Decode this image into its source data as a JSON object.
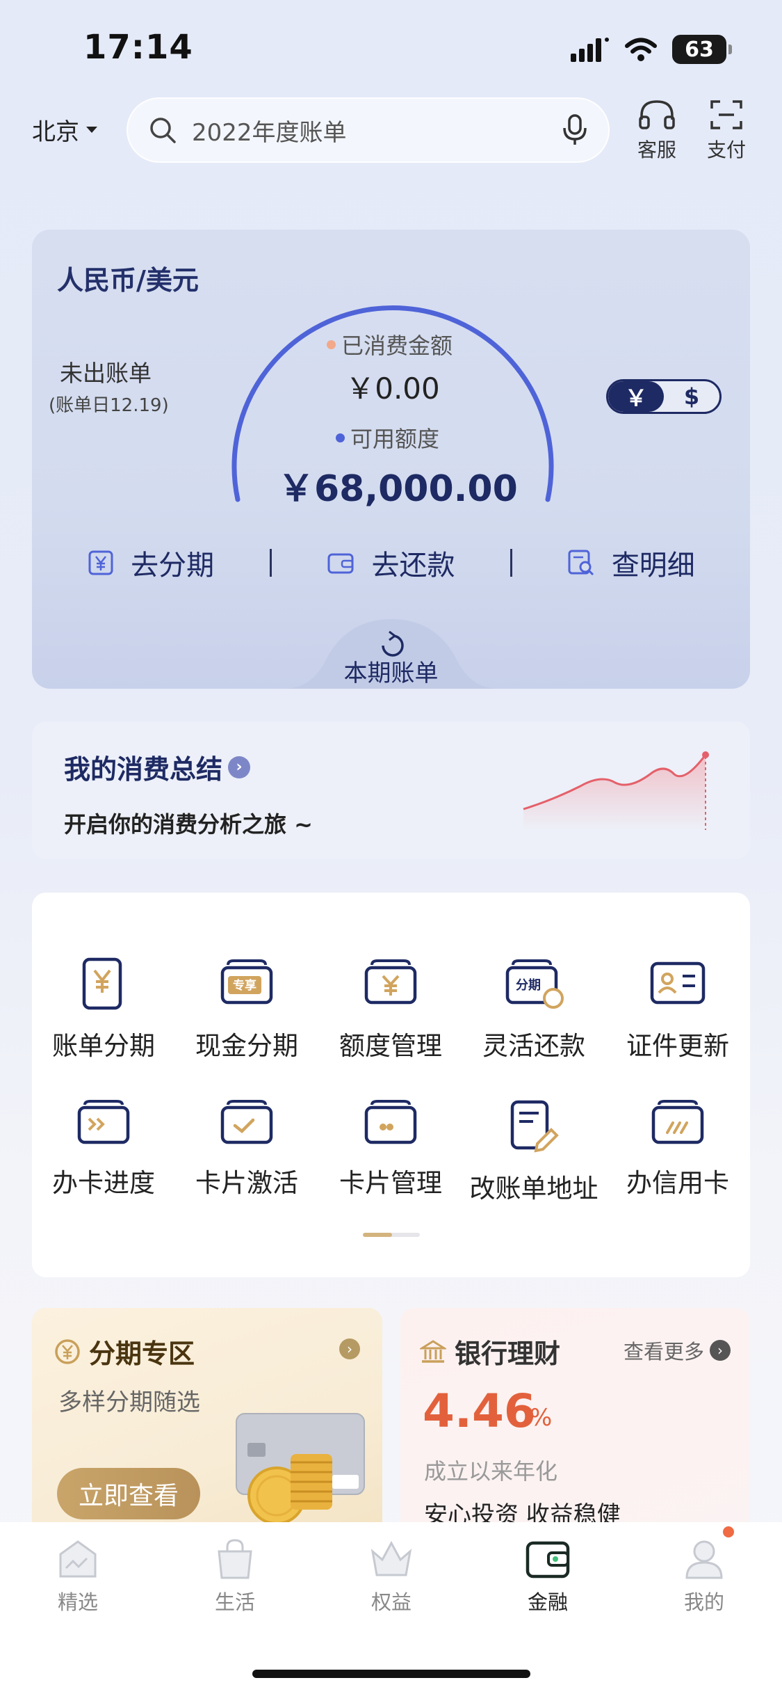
{
  "status": {
    "time": "17:14",
    "battery": "63"
  },
  "header": {
    "city": "北京",
    "search_placeholder": "2022年度账单",
    "service_label": "客服",
    "pay_label": "支付"
  },
  "card": {
    "currency_title": "人民币/美元",
    "bill_status": "未出账单",
    "bill_date": "(账单日12.19)",
    "used_label": "已消费金额",
    "used_value": "￥0.00",
    "available_label": "可用额度",
    "available_value": "￥68,000.00",
    "currency_toggle": [
      "￥",
      "$"
    ],
    "actions": [
      {
        "label": "去分期",
        "icon": "yuan-icon"
      },
      {
        "label": "去还款",
        "icon": "wallet-icon"
      },
      {
        "label": "查明细",
        "icon": "detail-search-icon"
      }
    ],
    "bill_tab_label": "本期账单",
    "colors": {
      "gauge": "#4f63d8",
      "used_dot": "#f2a98a",
      "avail_dot": "#4f63d8"
    }
  },
  "summary": {
    "title": "我的消费总结",
    "subtitle": "开启你的消费分析之旅 ~"
  },
  "menu": {
    "items": [
      {
        "label": "账单分期",
        "icon": "bill-installment-icon"
      },
      {
        "label": "现金分期",
        "icon": "cash-installment-icon",
        "badge": "专享"
      },
      {
        "label": "额度管理",
        "icon": "limit-management-icon"
      },
      {
        "label": "灵活还款",
        "icon": "flexible-repay-icon",
        "badge": "分期"
      },
      {
        "label": "证件更新",
        "icon": "id-update-icon"
      },
      {
        "label": "办卡进度",
        "icon": "card-progress-icon"
      },
      {
        "label": "卡片激活",
        "icon": "card-activate-icon"
      },
      {
        "label": "卡片管理",
        "icon": "card-manage-icon"
      },
      {
        "label": "改账单地址",
        "icon": "bill-address-icon"
      },
      {
        "label": "办信用卡",
        "icon": "apply-card-icon"
      }
    ]
  },
  "promo_left": {
    "title": "分期专区",
    "subtitle": "多样分期随选",
    "button": "立即查看"
  },
  "promo_right": {
    "title": "银行理财",
    "more": "查看更多",
    "rate": "4.46",
    "rate_unit": "%",
    "desc": "成立以来年化",
    "tagline": "安心投资 收益稳健"
  },
  "tabbar": {
    "items": [
      {
        "label": "精选",
        "icon": "featured-icon"
      },
      {
        "label": "生活",
        "icon": "life-bag-icon"
      },
      {
        "label": "权益",
        "icon": "crown-icon"
      },
      {
        "label": "金融",
        "icon": "finance-wallet-icon",
        "active": true
      },
      {
        "label": "我的",
        "icon": "profile-icon"
      }
    ]
  }
}
